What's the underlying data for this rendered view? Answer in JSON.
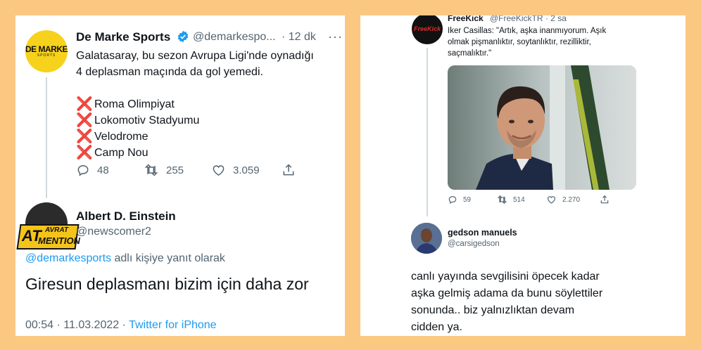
{
  "left_tweet": {
    "avatar_text": "DE MARKE",
    "avatar_subtext": "SPORTS",
    "author_name": "De Marke Sports",
    "handle": "@demarkespo...",
    "time": "· 12 dk",
    "more": "···",
    "text_line1": "Galatasaray, bu sezon Avrupa Ligi'nde oynadığı",
    "text_line2": "4 deplasman maçında da gol yemedi.",
    "list_mark": "❌",
    "list": [
      "Roma Olimpiyat",
      "Lokomotiv Stadyumu",
      "Velodrome",
      "Camp Nou"
    ],
    "replies": "48",
    "retweets": "255",
    "likes": "3.059"
  },
  "left_reply": {
    "watermark_top": "AVRAT",
    "watermark_left": "AT",
    "watermark_bottom": "MENTION",
    "author_name": "Albert D. Einstein",
    "handle": "@newscomer2",
    "reply_to_handle": "@demarkesports",
    "reply_to_suffix": " adlı kişiye yanıt olarak",
    "text": "Giresun deplasmanı bizim için daha zor",
    "timestamp": "00:54 · 11.03.2022 · ",
    "source": "Twitter for iPhone"
  },
  "right_tweet": {
    "avatar_text": "FreeKick",
    "author_name": "FreeKick",
    "handle": "@FreeKickTR · 2 sa",
    "text_line1": "Iker Casillas: \"Artık, aşka inanmıyorum. Aşık",
    "text_line2": "olmak pişmanlıktır, soytanlıktır, rezilliktir,",
    "text_line3": "saçmalıktır.\"",
    "replies": "59",
    "retweets": "514",
    "likes": "2.270"
  },
  "right_reply": {
    "author_name": "gedson manuels",
    "handle": "@carsigedson",
    "text_line1": "canlı yayında sevgilisini öpecek kadar",
    "text_line2": "aşka gelmiş adama da bunu söylettiler",
    "text_line3": "sonunda.. biz yalnızlıktan devam",
    "text_line4": "cidden ya."
  },
  "colors": {
    "background": "#fbc882",
    "link": "#1d9bf0",
    "verified": "#1d9bf0",
    "cross": "#e0245e",
    "brand_yellow": "#f7d21c"
  }
}
